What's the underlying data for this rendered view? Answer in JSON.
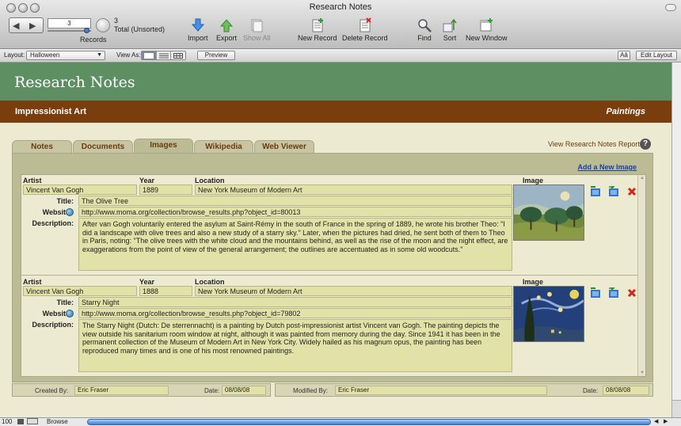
{
  "window": {
    "title": "Research Notes"
  },
  "toolbar": {
    "record_number": "3",
    "records_label": "Records",
    "total_count": "3",
    "total_label": "Total (Unsorted)",
    "buttons": {
      "import": "Import",
      "export": "Export",
      "show_all": "Show All",
      "new_record": "New Record",
      "delete_record": "Delete Record",
      "find": "Find",
      "sort": "Sort",
      "new_window": "New Window"
    }
  },
  "layoutbar": {
    "layout_label": "Layout:",
    "layout_value": "Halloween",
    "view_as_label": "View As:",
    "preview_label": "Preview",
    "text_size_label": "Aâ",
    "edit_layout_label": "Edit Layout"
  },
  "header": {
    "app_title": "Research Notes",
    "category": "Impressionist Art",
    "type": "Paintings"
  },
  "tabs": [
    {
      "label": "Notes"
    },
    {
      "label": "Documents"
    },
    {
      "label": "Images"
    },
    {
      "label": "Wikipedia"
    },
    {
      "label": "Web Viewer"
    }
  ],
  "report_link": "View Research Notes Report",
  "help_label": "?",
  "add_image_link": "Add a New Image",
  "columns": {
    "artist": "Artist",
    "year": "Year",
    "location": "Location",
    "image": "Image"
  },
  "field_labels": {
    "title": "Title:",
    "website": "Website:",
    "description": "Description:"
  },
  "records": [
    {
      "artist": "Vincent Van Gogh",
      "year": "1889",
      "location": "New York Museum of Modern Art",
      "title": "The Olive Tree",
      "website": "http://www.moma.org/collection/browse_results.php?object_id=80013",
      "description": "After van Gogh voluntarily entered the asylum at Saint-Rémy in the south of France in the spring of 1889, he wrote his brother Theo: \"I did a landscape with olive trees and also a new study of a starry sky.\" Later, when the pictures had dried, he sent both of them to Theo in Paris, noting: \"The olive trees with the white cloud and the mountains behind, as well as the rise of the moon and the night effect, are exaggerations from the point of view of the general arrangement; the outlines are accentuated as in some old woodcuts.\""
    },
    {
      "artist": "Vincent Van Gogh",
      "year": "1888",
      "location": "New York Museum of Modern Art",
      "title": "Starry Night",
      "website": "http://www.moma.org/collection/browse_results.php?object_id=79802",
      "description": "The Starry Night (Dutch: De sterrennacht) is a painting by Dutch post-impressionist artist Vincent van Gogh. The painting depicts the view outside his sanitarium room window at night, although it was painted from memory during the day. Since 1941 it has been in the permanent collection of the Museum of Modern Art in New York City. Widely hailed as his magnum opus, the painting has been reproduced many times and is one of his most renowned paintings."
    }
  ],
  "footer": {
    "created_by_label": "Created By:",
    "created_by": "Eric Fraser",
    "created_date_label": "Date:",
    "created_date": "08/08/08",
    "modified_by_label": "Modified By:",
    "modified_by": "Eric Fraser",
    "modified_date_label": "Date:",
    "modified_date": "08/08/08"
  },
  "statusbar": {
    "zoom": "100",
    "mode": "Browse"
  },
  "colors": {
    "green_header": "#5e8f63",
    "brown_header": "#7a3e0e",
    "field_bg": "#e2e2a8",
    "panel_bg": "#bcbc94",
    "link": "#1a3fa0"
  }
}
